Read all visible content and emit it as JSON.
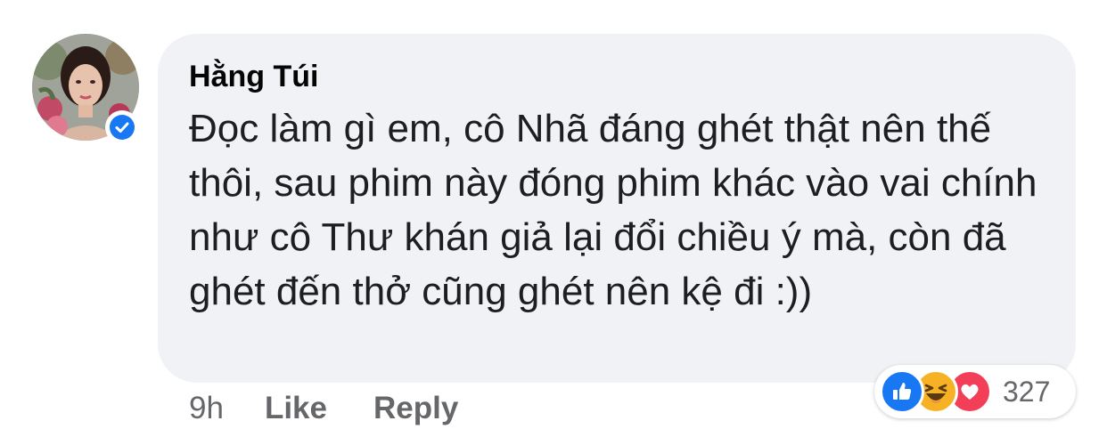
{
  "comment": {
    "author": "Hằng Túi",
    "text": "Đọc làm gì em, cô Nhã đáng ghét thật nên thế thôi, sau phim này đóng phim khác vào vai chính như cô Thư khán giả lại đổi chiều ý mà, còn đã ghét đến thở cũng ghét nên kệ đi :))",
    "time": "9h",
    "like_label": "Like",
    "reply_label": "Reply",
    "reaction_count": "327",
    "reactions": [
      "like-icon",
      "haha-icon",
      "love-icon"
    ]
  },
  "colors": {
    "bubble": "#f0f2f5",
    "meta_text": "#65676b",
    "verified": "#1877f2",
    "like": "#1877f2",
    "haha": "#f7b125",
    "love": "#f33e58"
  }
}
